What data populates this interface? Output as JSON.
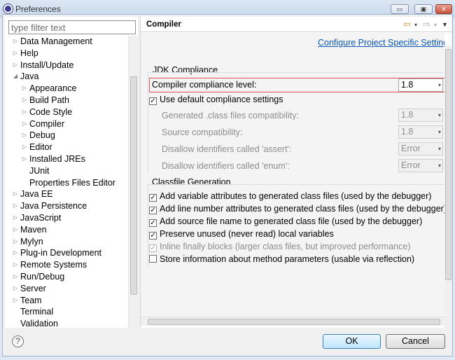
{
  "window": {
    "title": "Preferences",
    "minimize_label": "▭",
    "maximize_label": "▣",
    "close_label": "✕"
  },
  "filter": {
    "placeholder": "type filter text"
  },
  "tree": [
    {
      "label": "Data Management",
      "level": 0,
      "arrow": "▷"
    },
    {
      "label": "Help",
      "level": 0,
      "arrow": "▷"
    },
    {
      "label": "Install/Update",
      "level": 0,
      "arrow": "▷"
    },
    {
      "label": "Java",
      "level": 0,
      "arrow": "◢"
    },
    {
      "label": "Appearance",
      "level": 1,
      "arrow": "▷"
    },
    {
      "label": "Build Path",
      "level": 1,
      "arrow": "▷"
    },
    {
      "label": "Code Style",
      "level": 1,
      "arrow": "▷"
    },
    {
      "label": "Compiler",
      "level": 1,
      "arrow": "▷",
      "selected": true
    },
    {
      "label": "Debug",
      "level": 1,
      "arrow": "▷"
    },
    {
      "label": "Editor",
      "level": 1,
      "arrow": "▷"
    },
    {
      "label": "Installed JREs",
      "level": 1,
      "arrow": "▷"
    },
    {
      "label": "JUnit",
      "level": 1,
      "arrow": ""
    },
    {
      "label": "Properties Files Editor",
      "level": 1,
      "arrow": ""
    },
    {
      "label": "Java EE",
      "level": 0,
      "arrow": "▷"
    },
    {
      "label": "Java Persistence",
      "level": 0,
      "arrow": "▷"
    },
    {
      "label": "JavaScript",
      "level": 0,
      "arrow": "▷"
    },
    {
      "label": "Maven",
      "level": 0,
      "arrow": "▷"
    },
    {
      "label": "Mylyn",
      "level": 0,
      "arrow": "▷"
    },
    {
      "label": "Plug-in Development",
      "level": 0,
      "arrow": "▷"
    },
    {
      "label": "Remote Systems",
      "level": 0,
      "arrow": "▷"
    },
    {
      "label": "Run/Debug",
      "level": 0,
      "arrow": "▷"
    },
    {
      "label": "Server",
      "level": 0,
      "arrow": "▷"
    },
    {
      "label": "Team",
      "level": 0,
      "arrow": "▷"
    },
    {
      "label": "Terminal",
      "level": 0,
      "arrow": ""
    },
    {
      "label": "Validation",
      "level": 0,
      "arrow": ""
    }
  ],
  "page": {
    "title": "Compiler",
    "config_link": "Configure Project Specific Settings...",
    "nav_back": "⇦",
    "nav_fwd": "⇨",
    "dropdown_arrow": "▾",
    "menu_arrow": "▼"
  },
  "jdk": {
    "group_title": "JDK Compliance",
    "compliance_label": "Compiler compliance level:",
    "compliance_value": "1.8",
    "use_default_label": "Use default compliance settings",
    "use_default_checked": "✓",
    "generated_label": "Generated .class files compatibility:",
    "generated_value": "1.8",
    "source_label": "Source compatibility:",
    "source_value": "1.8",
    "assert_label": "Disallow identifiers called 'assert':",
    "assert_value": "Error",
    "enum_label": "Disallow identifiers called 'enum':",
    "enum_value": "Error"
  },
  "classfile": {
    "group_title": "Classfile Generation",
    "options": [
      {
        "label": "Add variable attributes to generated class files (used by the debugger)",
        "mark": "✓",
        "disabled": false
      },
      {
        "label": "Add line number attributes to generated class files (used by the debugger)",
        "mark": "✓",
        "disabled": false
      },
      {
        "label": "Add source file name to generated class file (used by the debugger)",
        "mark": "✓",
        "disabled": false
      },
      {
        "label": "Preserve unused (never read) local variables",
        "mark": "✓",
        "disabled": false
      },
      {
        "label": "Inline finally blocks (larger class files, but improved performance)",
        "mark": "✓",
        "disabled": true
      },
      {
        "label": "Store information about method parameters (usable via reflection)",
        "mark": "",
        "disabled": false
      }
    ]
  },
  "buttons": {
    "help": "?",
    "ok": "OK",
    "cancel": "Cancel"
  },
  "colors": {
    "link": "#0a56b5",
    "highlight_border": "#e05050",
    "default_button": "#bee6fd"
  }
}
